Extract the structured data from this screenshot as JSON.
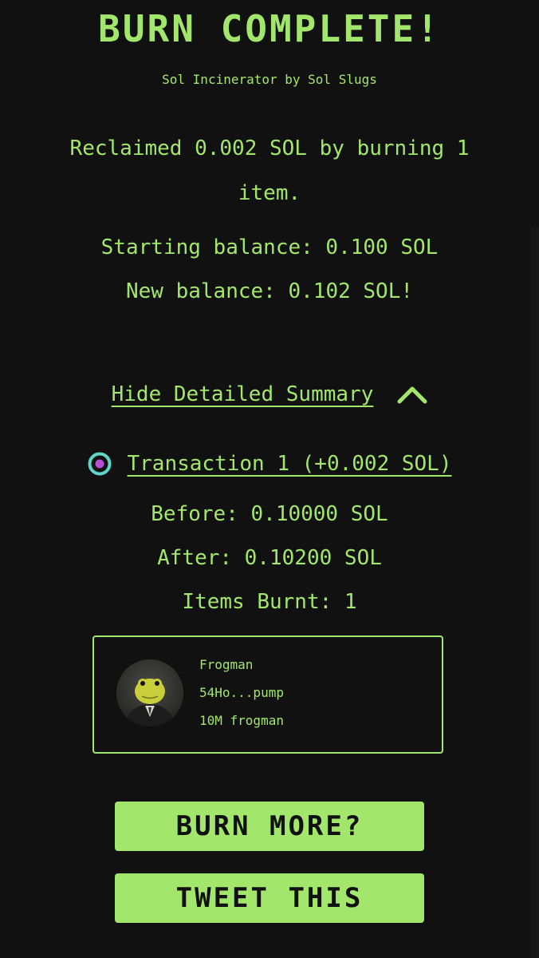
{
  "header": {
    "title": "BURN COMPLETE!",
    "subtitle": "Sol Incinerator by Sol Slugs"
  },
  "summary": {
    "reclaimed_text": "Reclaimed 0.002 SOL by burning 1 item.",
    "starting_balance": "Starting balance: 0.100 SOL",
    "new_balance": "New balance: 0.102 SOL!"
  },
  "details_toggle": {
    "label": "Hide Detailed Summary",
    "icon": "chevron-up-icon"
  },
  "transaction": {
    "label": "Transaction 1 (+0.002 SOL)",
    "icon": "solana-explorer-icon",
    "before": "Before: 0.10000 SOL",
    "after": "After: 0.10200 SOL",
    "items_burnt": "Items Burnt: 1"
  },
  "token": {
    "name": "Frogman",
    "address": "54Ho...pump",
    "amount": "10M frogman",
    "image": "frogman-avatar"
  },
  "buttons": {
    "burn_more": "BURN MORE?",
    "tweet": "TWEET THIS"
  },
  "colors": {
    "background": "#111111",
    "accent": "#a3e66c",
    "button_text": "#111111"
  }
}
